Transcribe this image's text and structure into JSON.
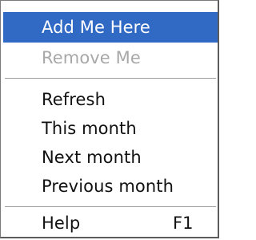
{
  "context_menu": {
    "items": [
      {
        "label": "Add Me Here",
        "state": "highlighted"
      },
      {
        "label": "Remove Me",
        "state": "disabled"
      },
      {
        "label": "Refresh",
        "state": "normal"
      },
      {
        "label": "This month",
        "state": "normal"
      },
      {
        "label": "Next month",
        "state": "normal"
      },
      {
        "label": "Previous month",
        "state": "normal"
      },
      {
        "label": "Help",
        "shortcut": "F1",
        "state": "normal"
      }
    ],
    "colors": {
      "highlight_background": "#316ac5",
      "highlight_text": "#ffffff",
      "disabled_text": "#a8a8a8",
      "text": "#111111"
    }
  }
}
